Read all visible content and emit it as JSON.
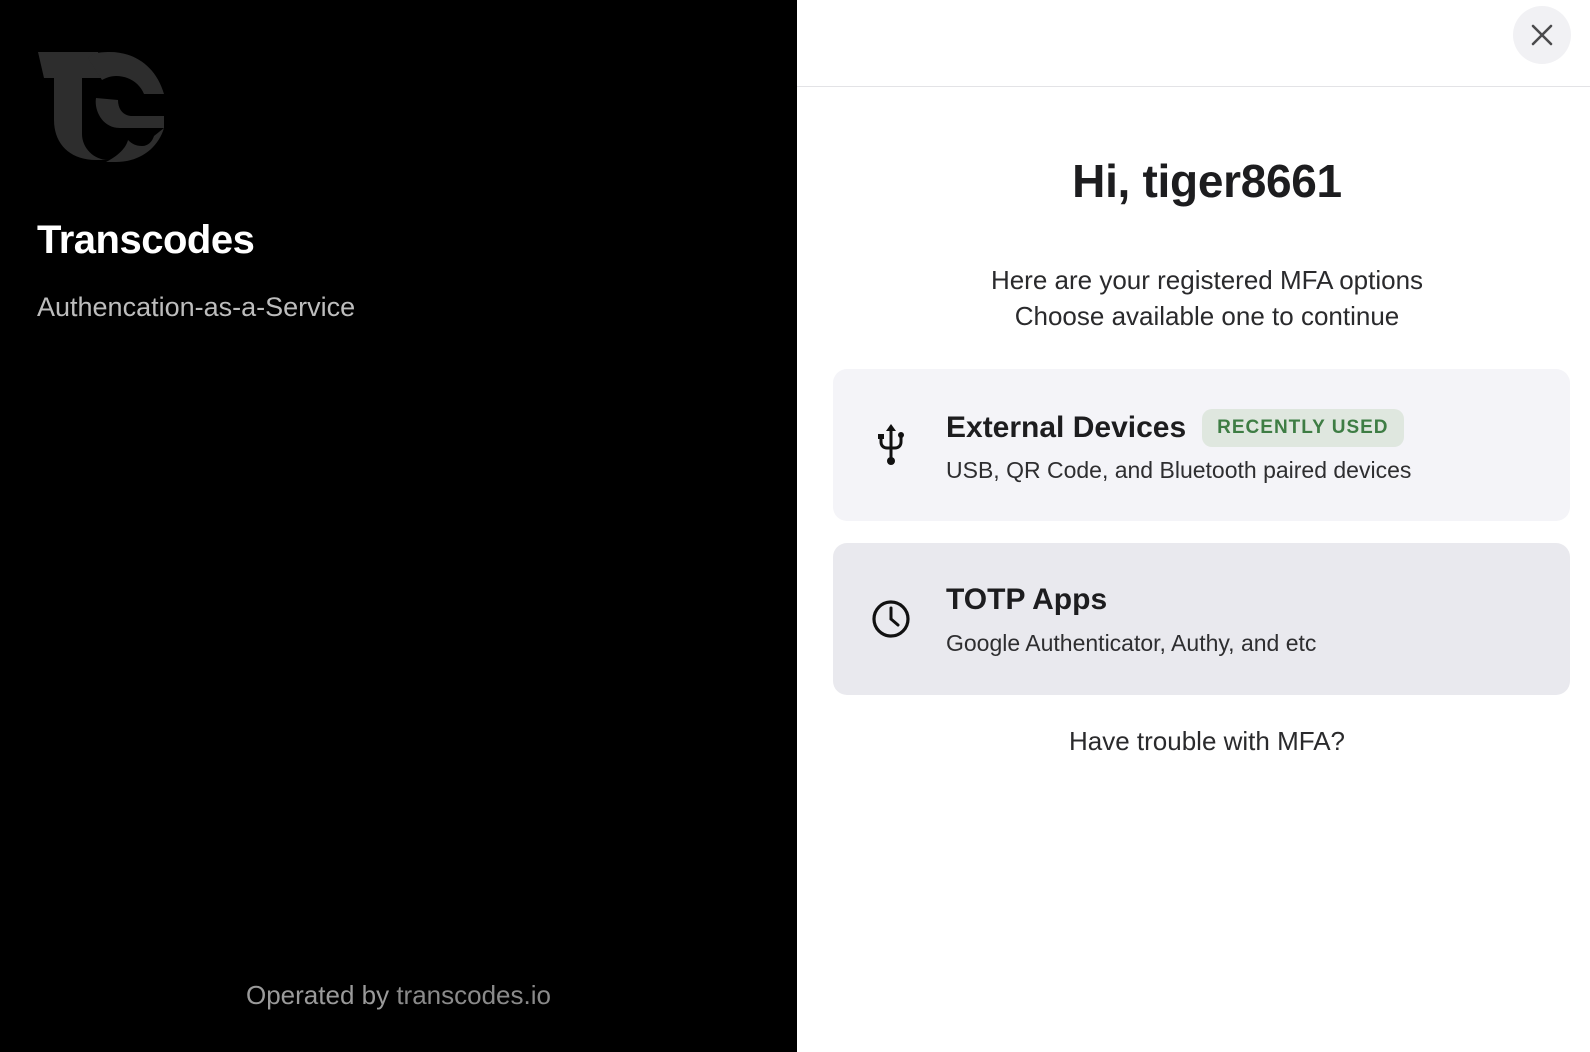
{
  "brand": {
    "name": "Transcodes",
    "tagline": "Authencation-as-a-Service",
    "footer_prefix": "Operated by",
    "footer_link": "transcodes.io",
    "logo_icon": "transcodes-logo"
  },
  "header": {
    "close_icon": "close-icon"
  },
  "main": {
    "greeting": "Hi, tiger8661",
    "instructions_line1": "Here are your registered MFA options",
    "instructions_line2": "Choose available one to continue",
    "options": [
      {
        "icon": "usb-icon",
        "title": "External Devices",
        "badge": "RECENTLY USED",
        "subtitle": "USB, QR Code, and Bluetooth paired devices"
      },
      {
        "icon": "clock-icon",
        "title": "TOTP Apps",
        "subtitle": "Google Authenticator, Authy, and etc"
      }
    ],
    "trouble_link": "Have trouble with MFA?"
  },
  "colors": {
    "left_background": "#000000",
    "right_background": "#ffffff",
    "card_primary": "#f4f4f8",
    "card_secondary": "#e9e9ee",
    "badge_background": "#dfe7df",
    "badge_text": "#3e7d44"
  }
}
